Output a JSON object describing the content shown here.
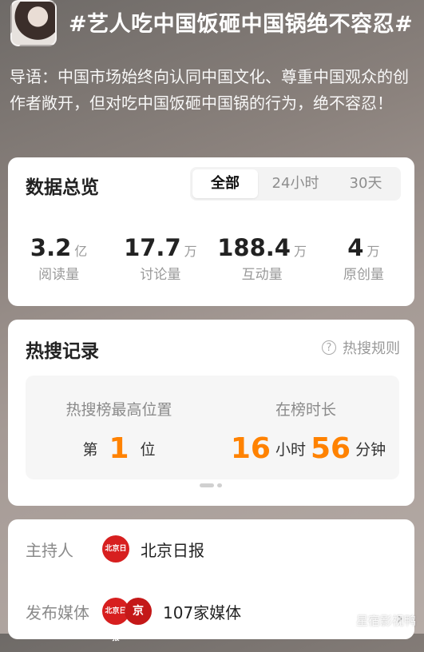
{
  "header": {
    "title": "#艺人吃中国饭砸中国锅绝不容忍#",
    "lead": "导语：中国市场始终向认同中国文化、尊重中国观众的创作者敞开，但对吃中国饭砸中国锅的行为，绝不容忍！"
  },
  "overview": {
    "title": "数据总览",
    "tabs": [
      "全部",
      "24小时",
      "30天"
    ],
    "active_tab": "全部",
    "stats": [
      {
        "value": "3.2",
        "unit": "亿",
        "label": "阅读量"
      },
      {
        "value": "17.7",
        "unit": "万",
        "label": "讨论量"
      },
      {
        "value": "188.4",
        "unit": "万",
        "label": "互动量"
      },
      {
        "value": "4",
        "unit": "万",
        "label": "原创量"
      }
    ]
  },
  "hot": {
    "title": "热搜记录",
    "rules_label": "热搜规则",
    "peak_label": "热搜榜最高位置",
    "peak_prefix": "第",
    "peak_value": "1",
    "peak_suffix": "位",
    "duration_label": "在榜时长",
    "hours": "16",
    "hours_unit": "小时",
    "minutes": "56",
    "minutes_unit": "分钟"
  },
  "info": {
    "host_label": "主持人",
    "host_value": "北京日报",
    "media_label": "发布媒体",
    "media_value": "107家媒体",
    "logo2_text": "京"
  },
  "watermark": "星宿影视鸭",
  "icons": {
    "help": "question-circle-icon",
    "chevron": "chevron-right-icon"
  },
  "colors": {
    "accent": "#ff8200",
    "logo_red": "#d71f1f"
  }
}
